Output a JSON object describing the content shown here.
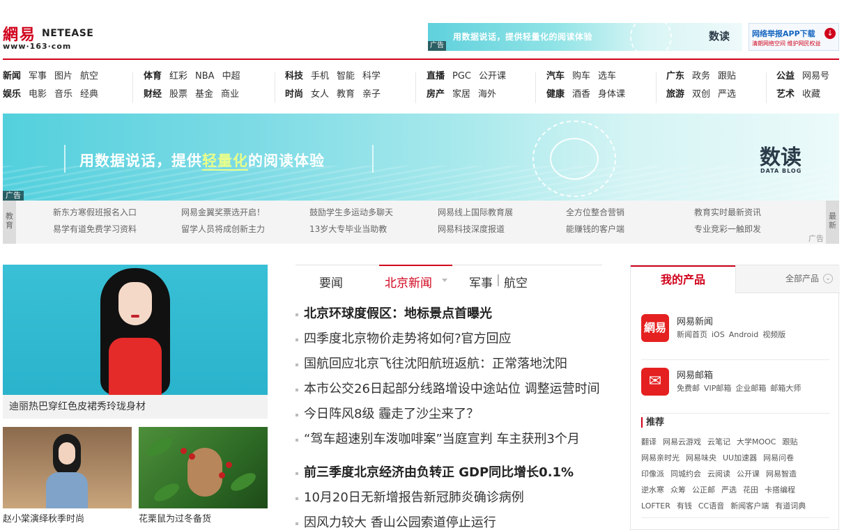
{
  "header": {
    "logo_cn": "網易",
    "logo_en": "NETEASE",
    "logo_url": "www·163·com",
    "top_ad_slogan": "用数据说话，提供轻量化的阅读体验",
    "top_ad_brand": "数读",
    "ad_label": "广告",
    "report_title": "网络举报APP下载",
    "report_sub": "清朗网络空间  维护网民权益"
  },
  "nav": {
    "groups": [
      {
        "row1": [
          "新闻",
          "军事",
          "图片",
          "航空"
        ],
        "row2": [
          "娱乐",
          "电影",
          "音乐",
          "经典"
        ]
      },
      {
        "row1": [
          "体育",
          "红彩",
          "NBA",
          "中超"
        ],
        "row2": [
          "财经",
          "股票",
          "基金",
          "商业"
        ]
      },
      {
        "row1": [
          "科技",
          "手机",
          "智能",
          "科学"
        ],
        "row2": [
          "时尚",
          "女人",
          "教育",
          "亲子"
        ]
      },
      {
        "row1": [
          "直播",
          "PGC",
          "公开课"
        ],
        "row2": [
          "房产",
          "家居",
          "海外"
        ]
      },
      {
        "row1": [
          "汽车",
          "购车",
          "选车"
        ],
        "row2": [
          "健康",
          "酒香",
          "身体课"
        ]
      },
      {
        "row1": [
          "广东",
          "政务",
          "跟贴"
        ],
        "row2": [
          "旅游",
          "双创",
          "严选"
        ]
      },
      {
        "row1": [
          "公益",
          "网易号"
        ],
        "row2": [
          "艺术",
          "收藏"
        ]
      }
    ]
  },
  "banner": {
    "slogan_a": "用数据说话，提供",
    "slogan_hl": "轻量化",
    "slogan_b": "的阅读体验",
    "brand": "数读",
    "brand_sub": "DATA BLOG",
    "ad_label": "广告"
  },
  "text_ads": {
    "left_label": "教育",
    "right_label": "最新",
    "row1": [
      "新东方寒假班报名入口",
      "网易金翼奖票选开启！",
      "鼓励学生多运动多聊天",
      "网易线上国际教育展",
      "全方位整合营销",
      "教育实时最新资讯"
    ],
    "row2": [
      "易学有道免费学习资料",
      "留学人员将成创新主力",
      "13岁大专毕业当助教",
      "网易科技深度报道",
      "能赚钱的客户端",
      "专业竞彩一触即发"
    ],
    "ad_label": "广告"
  },
  "photos": {
    "main_caption": "迪丽热巴穿红色皮裙秀玲珑身材",
    "small1_caption": "赵小棠演绎秋季时尚",
    "small2_caption": "花栗鼠为过冬备货"
  },
  "news_tabs": {
    "tab1": "要闻",
    "tab2": "北京新闻",
    "tab3": "军事",
    "tab4": "航空"
  },
  "news": {
    "group1": [
      "北京环球度假区：地标景点首曝光",
      "四季度北京物价走势将如何?官方回应",
      "国航回应北京飞往沈阳航班返航：正常落地沈阳",
      "本市公交26日起部分线路增设中途站位 调整运营时间",
      "今日阵风8级 霾走了沙尘来了？",
      "“驾车超速别车泼咖啡案”当庭宣判 车主获刑3个月"
    ],
    "group2": [
      "前三季度北京经济由负转正 GDP同比增长0.1%",
      "10月20日无新增报告新冠肺炎确诊病例",
      "因风力较大 香山公园索道停止运行"
    ]
  },
  "products": {
    "tab_mine": "我的产品",
    "tab_all": "全部产品",
    "news_app": {
      "icon_text": "網易",
      "name": "网易新闻",
      "links": [
        "新闻首页",
        "iOS",
        "Android",
        "视频版"
      ]
    },
    "mail": {
      "icon_text": "✉",
      "name": "网易邮箱",
      "links": [
        "免费邮",
        "VIP邮箱",
        "企业邮箱",
        "邮箱大师"
      ]
    },
    "recommend_title": "推荐",
    "recommend_rows": [
      [
        "翻译",
        "网易云游戏",
        "云笔记",
        "大学MOOC",
        "跟贴"
      ],
      [
        "网易亲时光",
        "网易味央",
        "UU加速器",
        "网易问卷"
      ],
      [
        "印像派",
        "同城约会",
        "云阅读",
        "公开课",
        "网易智造"
      ],
      [
        "逆水寒",
        "众筹",
        "公正邮",
        "严选",
        "花田",
        "卡搭编程"
      ],
      [
        "LOFTER",
        "有钱",
        "CC语音",
        "新闻客户端",
        "有道词典"
      ]
    ]
  }
}
